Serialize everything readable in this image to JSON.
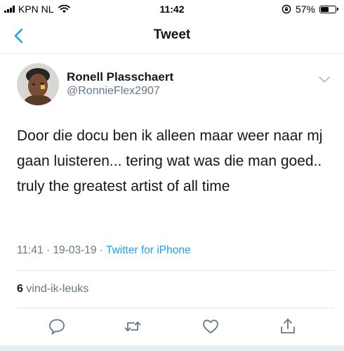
{
  "status_bar": {
    "carrier": "KPN NL",
    "time": "11:42",
    "battery_percent": "57%",
    "battery_level": 0.57
  },
  "nav": {
    "title": "Tweet"
  },
  "tweet": {
    "author_name": "Ronell Plasschaert",
    "author_handle": "@RonnieFlex2907",
    "text": "Door die docu ben ik alleen maar weer naar mj gaan luisteren... tering wat was die man goed.. truly the greatest artist of all time",
    "time": "11:41",
    "date": "19-03-19",
    "source": "Twitter for iPhone",
    "separator": "·"
  },
  "stats": {
    "likes_count": "6",
    "likes_label": "vind-ik-leuks"
  },
  "colors": {
    "accent": "#1da1f2",
    "secondary_text": "#657786",
    "divider": "#e1e8ed"
  },
  "icons": [
    "back-chevron-icon",
    "reply-icon",
    "retweet-icon",
    "like-icon",
    "share-icon",
    "chevron-down-icon"
  ]
}
